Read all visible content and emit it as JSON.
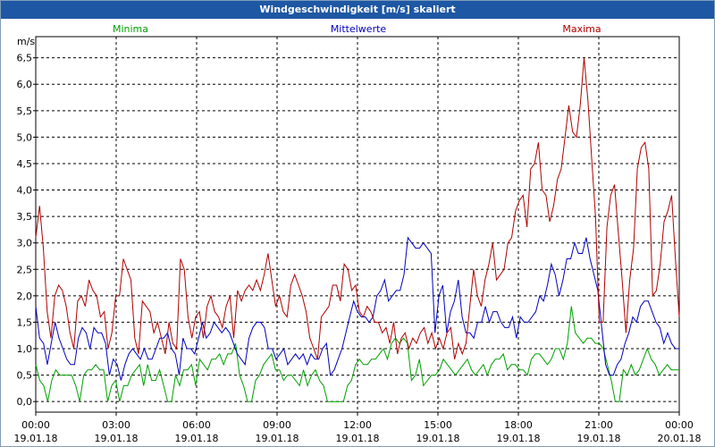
{
  "window": {
    "title": "Windgeschwindigkeit [m/s] skaliert"
  },
  "chart_data": {
    "type": "line",
    "title": "Windgeschwindigkeit [m/s] skaliert",
    "ylabel": "m/s",
    "ylim": [
      -0.2,
      6.9
    ],
    "y_ticks": [
      "0,0",
      "0,5",
      "1,0",
      "1,5",
      "2,0",
      "2,5",
      "3,0",
      "3,5",
      "4,0",
      "4,5",
      "5,0",
      "5,5",
      "6,0",
      "6,5"
    ],
    "x_ticks": [
      {
        "time": "00:00",
        "date": "19.01.18"
      },
      {
        "time": "03:00",
        "date": "19.01.18"
      },
      {
        "time": "06:00",
        "date": "19.01.18"
      },
      {
        "time": "09:00",
        "date": "19.01.18"
      },
      {
        "time": "12:00",
        "date": "19.01.18"
      },
      {
        "time": "15:00",
        "date": "19.01.18"
      },
      {
        "time": "18:00",
        "date": "19.01.18"
      },
      {
        "time": "21:00",
        "date": "19.01.18"
      },
      {
        "time": "00:00",
        "date": "20.01.18"
      }
    ],
    "grid": true,
    "x_sample_interval_minutes": 10,
    "series": [
      {
        "name": "Minima",
        "color": "#00a000",
        "values": [
          0.7,
          0.4,
          0.3,
          0.0,
          0.4,
          0.6,
          0.5,
          0.5,
          0.5,
          0.5,
          0.3,
          0.0,
          0.5,
          0.6,
          0.6,
          0.7,
          0.6,
          0.6,
          0.0,
          0.3,
          0.4,
          0.0,
          0.3,
          0.3,
          0.5,
          0.6,
          0.7,
          0.3,
          0.7,
          0.4,
          0.4,
          0.6,
          0.3,
          0.0,
          0.0,
          0.5,
          0.3,
          0.6,
          0.6,
          0.7,
          0.3,
          0.8,
          0.7,
          0.6,
          0.8,
          0.8,
          0.9,
          0.7,
          0.9,
          0.9,
          1.1,
          0.5,
          0.3,
          0.0,
          0.0,
          0.4,
          0.5,
          0.7,
          0.8,
          0.9,
          0.6,
          0.6,
          0.4,
          0.5,
          0.5,
          0.4,
          0.3,
          0.6,
          0.3,
          0.5,
          0.6,
          0.4,
          0.3,
          0.0,
          0.0,
          0.0,
          0.0,
          0.0,
          0.3,
          0.4,
          0.7,
          0.8,
          0.7,
          0.7,
          0.8,
          0.8,
          0.9,
          1.0,
          0.8,
          1.1,
          1.2,
          1.1,
          1.2,
          1.1,
          0.4,
          0.5,
          0.8,
          0.3,
          0.4,
          0.5,
          0.5,
          0.6,
          0.8,
          0.7,
          0.6,
          0.5,
          0.6,
          0.7,
          0.8,
          0.6,
          0.5,
          0.6,
          0.7,
          0.5,
          0.7,
          0.8,
          0.8,
          0.9,
          0.6,
          0.7,
          0.7,
          0.6,
          0.6,
          0.5,
          0.8,
          0.9,
          0.9,
          0.8,
          0.7,
          0.8,
          1.0,
          1.0,
          0.8,
          1.1,
          1.8,
          1.3,
          1.2,
          1.1,
          1.2,
          1.2,
          1.1,
          1.1,
          1.0,
          0.7,
          0.4,
          0.0,
          0.0,
          0.6,
          0.5,
          0.7,
          0.5,
          0.6,
          0.8,
          1.0,
          0.8,
          0.7,
          0.5,
          0.6,
          0.7,
          0.6,
          0.6,
          0.6
        ]
      },
      {
        "name": "Mittelwerte",
        "color": "#0000c0",
        "values": [
          1.8,
          1.2,
          1.1,
          0.7,
          1.1,
          1.5,
          1.2,
          1.0,
          0.8,
          0.7,
          0.7,
          1.2,
          1.4,
          1.3,
          1.0,
          1.4,
          1.3,
          1.3,
          1.1,
          0.5,
          0.8,
          0.7,
          0.4,
          0.7,
          0.9,
          1.0,
          0.9,
          0.8,
          1.0,
          0.8,
          0.8,
          1.0,
          1.2,
          1.2,
          1.3,
          1.0,
          0.9,
          0.5,
          1.2,
          1.0,
          1.0,
          0.9,
          1.2,
          1.5,
          1.2,
          1.3,
          1.5,
          1.4,
          1.3,
          1.4,
          1.3,
          1.1,
          0.9,
          0.8,
          0.7,
          1.2,
          1.4,
          1.5,
          1.5,
          1.4,
          1.0,
          1.0,
          0.8,
          0.9,
          1.0,
          0.7,
          0.8,
          0.9,
          0.8,
          0.9,
          0.7,
          0.9,
          0.8,
          0.8,
          1.0,
          1.1,
          0.5,
          0.6,
          0.8,
          1.0,
          1.3,
          1.6,
          1.9,
          1.7,
          1.6,
          1.6,
          1.5,
          1.6,
          2.0,
          2.1,
          2.3,
          1.9,
          2.0,
          2.1,
          2.1,
          2.4,
          3.1,
          3.0,
          2.9,
          2.9,
          3.0,
          2.9,
          2.8,
          1.3,
          2.0,
          2.2,
          1.3,
          1.7,
          1.9,
          2.3,
          1.6,
          1.3,
          1.3,
          1.2,
          1.5,
          1.5,
          1.8,
          1.5,
          1.7,
          1.7,
          1.5,
          1.4,
          1.4,
          1.6,
          1.2,
          1.6,
          1.5,
          1.5,
          1.6,
          1.7,
          2.0,
          1.9,
          2.2,
          2.6,
          2.4,
          2.0,
          2.3,
          2.7,
          2.7,
          3.0,
          2.8,
          2.8,
          3.1,
          2.7,
          2.4,
          2.1,
          1.4,
          0.7,
          0.5,
          0.5,
          0.7,
          0.8,
          1.1,
          1.3,
          1.6,
          1.5,
          1.8,
          1.9,
          1.9,
          1.7,
          1.5,
          1.4,
          1.1,
          1.3,
          1.1,
          1.0,
          1.0
        ]
      },
      {
        "name": "Maxima",
        "color": "#b00000",
        "values": [
          3.1,
          3.7,
          2.9,
          1.7,
          1.2,
          2.0,
          2.2,
          2.1,
          1.8,
          1.3,
          1.0,
          1.9,
          2.0,
          1.8,
          2.3,
          2.1,
          2.0,
          1.6,
          1.7,
          1.0,
          1.3,
          2.0,
          2.0,
          2.7,
          2.5,
          2.3,
          1.2,
          0.9,
          1.9,
          1.8,
          1.7,
          1.3,
          1.5,
          1.2,
          0.9,
          1.5,
          1.1,
          1.0,
          2.7,
          2.5,
          1.6,
          1.2,
          1.6,
          1.7,
          1.2,
          1.8,
          2.0,
          1.7,
          1.6,
          1.4,
          1.8,
          2.0,
          1.2,
          2.1,
          1.9,
          2.1,
          2.2,
          2.1,
          2.3,
          2.1,
          2.4,
          2.8,
          2.3,
          1.8,
          2.0,
          1.7,
          1.6,
          2.2,
          2.4,
          2.2,
          2.0,
          1.7,
          1.2,
          1.0,
          0.8,
          1.6,
          1.7,
          1.8,
          2.2,
          2.2,
          1.9,
          2.6,
          2.5,
          2.1,
          2.2,
          1.7,
          1.6,
          1.8,
          1.7,
          1.5,
          1.5,
          1.3,
          1.4,
          1.1,
          1.5,
          0.9,
          1.2,
          1.3,
          1.0,
          1.2,
          1.1,
          1.3,
          1.4,
          1.1,
          1.3,
          1.0,
          1.2,
          1.0,
          1.3,
          1.4,
          0.8,
          1.1,
          0.9,
          1.1,
          1.8,
          2.5,
          2.0,
          1.8,
          2.3,
          2.6,
          3.0,
          2.3,
          2.4,
          2.5,
          3.0,
          3.1,
          3.6,
          3.8,
          3.9,
          3.3,
          4.4,
          4.5,
          4.9,
          4.0,
          3.9,
          3.4,
          3.7,
          4.2,
          4.4,
          5.0,
          5.6,
          5.1,
          5.0,
          5.6,
          6.5,
          5.7,
          4.6,
          3.5,
          1.5,
          1.5,
          3.3,
          3.9,
          4.1,
          3.2,
          2.3,
          1.3,
          2.3,
          2.9,
          4.4,
          4.8,
          4.9,
          4.4,
          2.0,
          2.1,
          2.6,
          3.4,
          3.6,
          3.9,
          2.7,
          1.6
        ]
      }
    ]
  }
}
